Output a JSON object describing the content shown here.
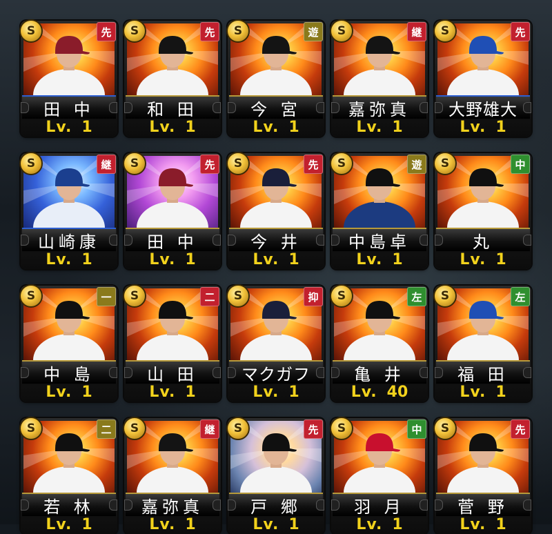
{
  "grade_label": "S",
  "level_label": "Lv.",
  "colors": {
    "pos_red": "#c2202e",
    "pos_olive": "#8a7a1c",
    "pos_green": "#2f8f2f",
    "level_yellow": "#f2d21c"
  },
  "cards": [
    {
      "name": "田 中",
      "pos": "先",
      "pos_color": "red",
      "level": "1",
      "bg": "fire",
      "cap": "#8a1c2a",
      "jersey": "#f4f4f4",
      "rim": "blue"
    },
    {
      "name": "和 田",
      "pos": "先",
      "pos_color": "red",
      "level": "1",
      "bg": "fire",
      "cap": "#141414",
      "jersey": "#f4f4f4",
      "rim": "gold"
    },
    {
      "name": "今 宮",
      "pos": "遊",
      "pos_color": "olive",
      "level": "1",
      "bg": "fire",
      "cap": "#141414",
      "jersey": "#f4f4f4",
      "rim": "gold"
    },
    {
      "name": "嘉弥真",
      "pos": "継",
      "pos_color": "red",
      "level": "1",
      "bg": "fire",
      "cap": "#141414",
      "jersey": "#f4f4f4",
      "rim": "gold"
    },
    {
      "name": "大野雄大",
      "pos": "先",
      "pos_color": "red",
      "level": "1",
      "bg": "fire",
      "cap": "#1f4fb5",
      "jersey": "#f4f4f4",
      "rim": "blue"
    },
    {
      "name": "山崎康",
      "pos": "継",
      "pos_color": "red",
      "level": "1",
      "bg": "blue",
      "cap": "#1b3f8f",
      "jersey": "#e8eef8",
      "rim": "blue"
    },
    {
      "name": "田 中",
      "pos": "先",
      "pos_color": "red",
      "level": "1",
      "bg": "pink",
      "cap": "#8a1c2a",
      "jersey": "#f4f4f4",
      "rim": "gold"
    },
    {
      "name": "今 井",
      "pos": "先",
      "pos_color": "red",
      "level": "1",
      "bg": "fire",
      "cap": "#1a1f3a",
      "jersey": "#f4f4f4",
      "rim": "gold"
    },
    {
      "name": "中島卓",
      "pos": "遊",
      "pos_color": "olive",
      "level": "1",
      "bg": "fire",
      "cap": "#101010",
      "jersey": "#1c3b80",
      "rim": "gold"
    },
    {
      "name": "丸",
      "pos": "中",
      "pos_color": "green",
      "level": "1",
      "bg": "fire",
      "cap": "#101010",
      "jersey": "#f4f4f4",
      "rim": "gold"
    },
    {
      "name": "中 島",
      "pos": "一",
      "pos_color": "olive",
      "level": "1",
      "bg": "fire",
      "cap": "#101010",
      "jersey": "#f4f4f4",
      "rim": "gold"
    },
    {
      "name": "山 田",
      "pos": "二",
      "pos_color": "red",
      "level": "1",
      "bg": "fire",
      "cap": "#101010",
      "jersey": "#f4f4f4",
      "rim": "gold"
    },
    {
      "name": "マクガフ",
      "pos": "抑",
      "pos_color": "red",
      "level": "1",
      "bg": "fire",
      "cap": "#1a1f3a",
      "jersey": "#f4f4f4",
      "rim": "gold"
    },
    {
      "name": "亀 井",
      "pos": "左",
      "pos_color": "green",
      "level": "40",
      "bg": "fire",
      "cap": "#101010",
      "jersey": "#f4f4f4",
      "rim": "gold"
    },
    {
      "name": "福 田",
      "pos": "左",
      "pos_color": "green",
      "level": "1",
      "bg": "fire",
      "cap": "#1f4fb5",
      "jersey": "#f4f4f4",
      "rim": "gold"
    },
    {
      "name": "若 林",
      "pos": "二",
      "pos_color": "olive",
      "level": "1",
      "bg": "fire",
      "cap": "#101010",
      "jersey": "#f4f4f4",
      "rim": "gold"
    },
    {
      "name": "嘉弥真",
      "pos": "継",
      "pos_color": "red",
      "level": "1",
      "bg": "fire",
      "cap": "#141414",
      "jersey": "#f4f4f4",
      "rim": "gold"
    },
    {
      "name": "戸 郷",
      "pos": "先",
      "pos_color": "red",
      "level": "1",
      "bg": "ice",
      "cap": "#101010",
      "jersey": "#f4f4f4",
      "rim": "gold"
    },
    {
      "name": "羽 月",
      "pos": "中",
      "pos_color": "green",
      "level": "1",
      "bg": "fire",
      "cap": "#c8102e",
      "jersey": "#f4f4f4",
      "rim": "gold"
    },
    {
      "name": "菅 野",
      "pos": "先",
      "pos_color": "red",
      "level": "1",
      "bg": "fire",
      "cap": "#101010",
      "jersey": "#f4f4f4",
      "rim": "gold"
    }
  ]
}
